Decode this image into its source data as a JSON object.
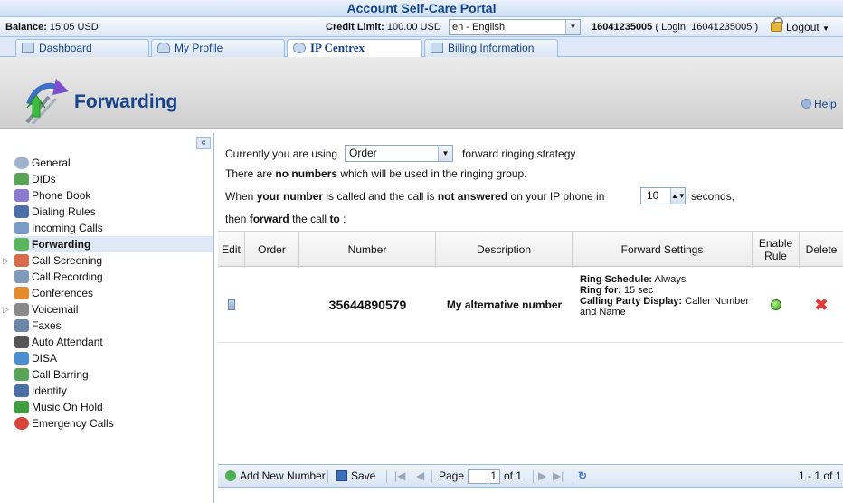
{
  "portal": {
    "title": "Account Self-Care Portal",
    "balance_label": "Balance:",
    "balance_value": "15.05 USD",
    "credit_label": "Credit Limit:",
    "credit_value": "100.00 USD",
    "language": "en - English",
    "account_number": "16041235005",
    "login_text": "( Login: 16041235005 )",
    "logout_label": "Logout"
  },
  "tabs": [
    {
      "label": "Dashboard"
    },
    {
      "label": "My Profile"
    },
    {
      "label": "IP Centrex"
    },
    {
      "label": "Billing Information"
    }
  ],
  "header": {
    "title": "Forwarding",
    "help_label": "Help"
  },
  "sidebar": {
    "items": [
      {
        "label": "General"
      },
      {
        "label": "DIDs"
      },
      {
        "label": "Phone Book"
      },
      {
        "label": "Dialing Rules"
      },
      {
        "label": "Incoming Calls"
      },
      {
        "label": "Forwarding"
      },
      {
        "label": "Call Screening"
      },
      {
        "label": "Call Recording"
      },
      {
        "label": "Conferences"
      },
      {
        "label": "Voicemail"
      },
      {
        "label": "Faxes"
      },
      {
        "label": "Auto Attendant"
      },
      {
        "label": "DISA"
      },
      {
        "label": "Call Barring"
      },
      {
        "label": "Identity"
      },
      {
        "label": "Music On Hold"
      },
      {
        "label": "Emergency Calls"
      }
    ]
  },
  "config": {
    "line1_prefix": "Currently you are using",
    "strategy": "Order",
    "line1_suffix": "forward ringing strategy.",
    "line2_a": "There are",
    "line2_b": "no numbers",
    "line2_c": "which will be used in the ringing group.",
    "line3_a": "When",
    "line3_b": "your number",
    "line3_c": "is called and the call is",
    "line3_d": "not answered",
    "line3_e": "on your IP phone in",
    "seconds_value": "10",
    "line3_f": "seconds,",
    "line4_a": "then",
    "line4_b": "forward",
    "line4_c": "the call",
    "line4_d": "to",
    "line4_e": ":"
  },
  "table": {
    "headers": {
      "edit": "Edit",
      "order": "Order",
      "number": "Number",
      "description": "Description",
      "forward_settings": "Forward Settings",
      "enable_rule_1": "Enable",
      "enable_rule_2": "Rule",
      "delete": "Delete"
    },
    "rows": [
      {
        "number": "35644890579",
        "description": "My alternative number",
        "ring_schedule_label": "Ring Schedule:",
        "ring_schedule_value": "Always",
        "ring_for_label": "Ring for:",
        "ring_for_value": "15 sec",
        "calling_party_label": "Calling Party Display:",
        "calling_party_value": "Caller Number and Name"
      }
    ]
  },
  "toolbar": {
    "add_label": "Add New Number",
    "save_label": "Save",
    "page_label": "Page",
    "page_value": "1",
    "of_label": "of 1",
    "range_label": "1 - 1 of 1"
  }
}
